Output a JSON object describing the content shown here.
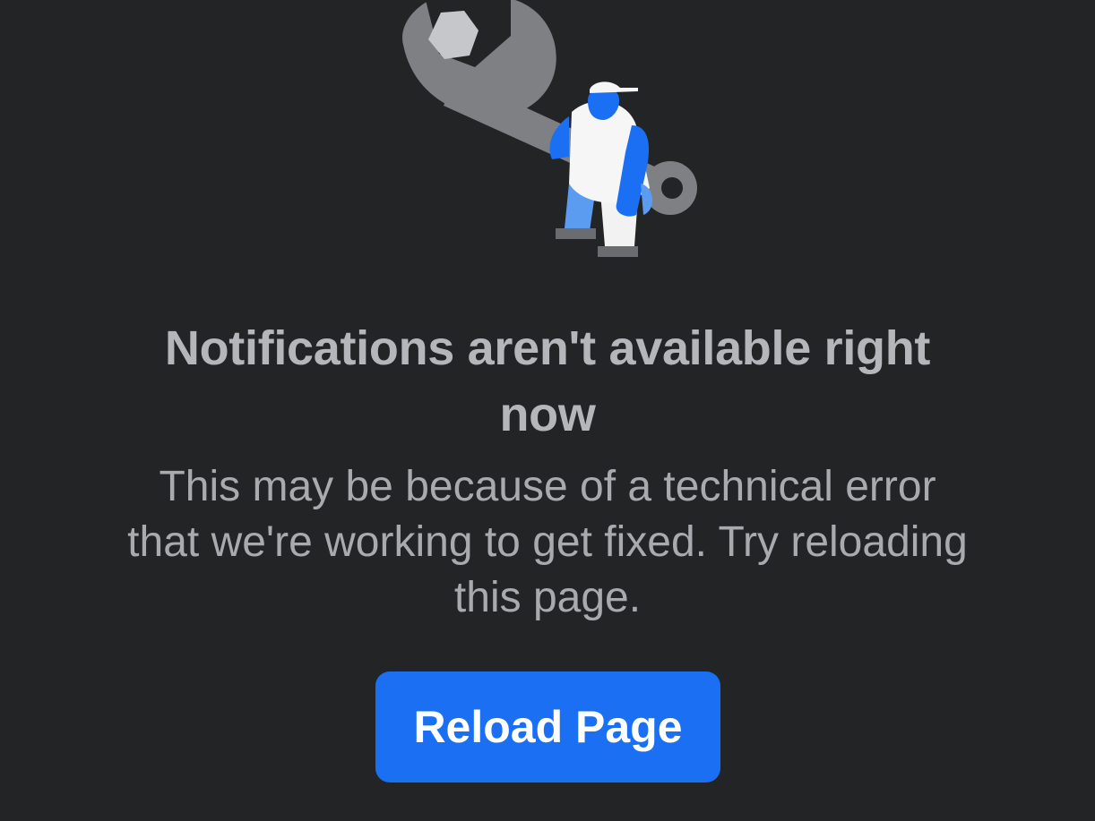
{
  "error": {
    "illustration": "wrench-worker-illustration",
    "title_lines": [
      "Notifications aren't available right",
      "now"
    ],
    "message_lines": [
      "This may be because of a technical error",
      "that we're working to get fixed. Try reloading",
      "this page."
    ],
    "reload_label": "Reload Page"
  },
  "colors": {
    "background": "#232426",
    "title": "#b5b6ba",
    "message": "#a9aaae",
    "button": "#1a6ff2",
    "button_text": "#ffffff"
  }
}
